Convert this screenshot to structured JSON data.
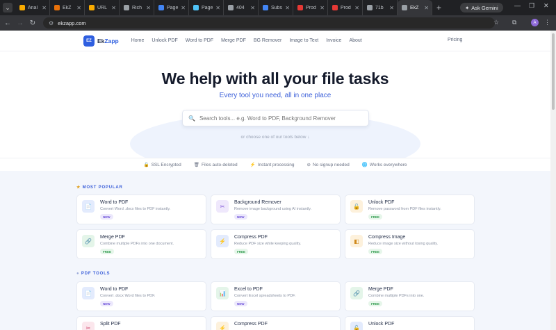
{
  "browser": {
    "tabs": [
      {
        "label": "Anal",
        "color": "#f9ab00"
      },
      {
        "label": "EkZ",
        "color": "#e8710a"
      },
      {
        "label": "URL",
        "color": "#f9ab00"
      },
      {
        "label": "Rich",
        "color": "#9aa0a6"
      },
      {
        "label": "Page",
        "color": "#4285f4"
      },
      {
        "label": "Page",
        "color": "#4fc3f7"
      },
      {
        "label": "404",
        "color": "#9aa0a6"
      },
      {
        "label": "Subs",
        "color": "#4285f4"
      },
      {
        "label": "Prod",
        "color": "#e53935"
      },
      {
        "label": "Prod",
        "color": "#e53935"
      },
      {
        "label": "71b",
        "color": "#9aa0a6"
      },
      {
        "label": "EkZ",
        "color": "#9aa0a6",
        "active": true
      }
    ],
    "ask_gemini": "Ask Gemini",
    "url": "ekzapp.com",
    "profile_initial": "A"
  },
  "nav": {
    "logo_mark": "EZ",
    "brand_prefix": "Ek",
    "brand_suffix": "Zapp",
    "links": [
      "Home",
      "Unlock PDF",
      "Word to PDF",
      "Merge PDF",
      "BG Remover",
      "Image to Text",
      "Invoice",
      "About"
    ],
    "pricing": "Pricing"
  },
  "hero": {
    "title": "We help with all your file tasks",
    "subtitle": "Every tool you need, all in one place",
    "search_placeholder": "Search tools... e.g. Word to PDF, Background Remover",
    "choose_hint": "or choose one of our tools below ↓"
  },
  "trust": [
    {
      "icon": "🔒",
      "label": "SSL Encrypted"
    },
    {
      "icon": "🗑",
      "label": "Files auto-deleted"
    },
    {
      "icon": "⚡",
      "label": "Instant processing"
    },
    {
      "icon": "⊘",
      "label": "No signup needed"
    },
    {
      "icon": "🌐",
      "label": "Works everywhere"
    }
  ],
  "sections": [
    {
      "title": "MOST POPULAR",
      "icon": "★",
      "cards": [
        {
          "title": "Word to PDF",
          "desc": "Convert Word .docx files to PDF instantly.",
          "badge": "NEW",
          "icon": "📄",
          "tone": "blue"
        },
        {
          "title": "Background Remover",
          "desc": "Remove image background using AI instantly.",
          "badge": "NEW",
          "icon": "✂",
          "tone": "purple"
        },
        {
          "title": "Unlock PDF",
          "desc": "Remove password from PDF files instantly.",
          "badge": "FREE",
          "icon": "🔓",
          "tone": "amber"
        },
        {
          "title": "Merge PDF",
          "desc": "Combine multiple PDFs into one document.",
          "badge": "FREE",
          "icon": "🔗",
          "tone": "green"
        },
        {
          "title": "Compress PDF",
          "desc": "Reduce PDF size while keeping quality.",
          "badge": "FREE",
          "icon": "⚡",
          "tone": "blue"
        },
        {
          "title": "Compress Image",
          "desc": "Reduce image size without losing quality.",
          "badge": "FREE",
          "icon": "◧",
          "tone": "amber"
        }
      ]
    },
    {
      "title": "PDF TOOLS",
      "icon": "●",
      "cards": [
        {
          "title": "Word to PDF",
          "desc": "Convert .docx Word files to PDF.",
          "badge": "NEW",
          "icon": "📄",
          "tone": "blue"
        },
        {
          "title": "Excel to PDF",
          "desc": "Convert Excel spreadsheets to PDF.",
          "badge": "NEW",
          "icon": "📊",
          "tone": "green"
        },
        {
          "title": "Merge PDF",
          "desc": "Combine multiple PDFs into one.",
          "badge": "FREE",
          "icon": "🔗",
          "tone": "green"
        },
        {
          "title": "Split PDF",
          "desc": "",
          "badge": "",
          "icon": "✂",
          "tone": "pink"
        },
        {
          "title": "Compress PDF",
          "desc": "",
          "badge": "",
          "icon": "⚡",
          "tone": "amber"
        },
        {
          "title": "Unlock PDF",
          "desc": "",
          "badge": "",
          "icon": "🔓",
          "tone": "blue"
        }
      ]
    }
  ]
}
